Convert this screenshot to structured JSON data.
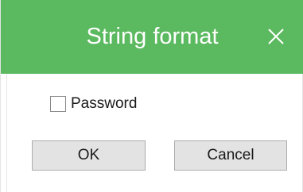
{
  "dialog": {
    "title": "String format",
    "close_icon": "close-icon",
    "accent_color": "#5bb95f"
  },
  "options": {
    "password_label": "Password",
    "password_checked": false
  },
  "buttons": {
    "ok_label": "OK",
    "cancel_label": "Cancel"
  }
}
